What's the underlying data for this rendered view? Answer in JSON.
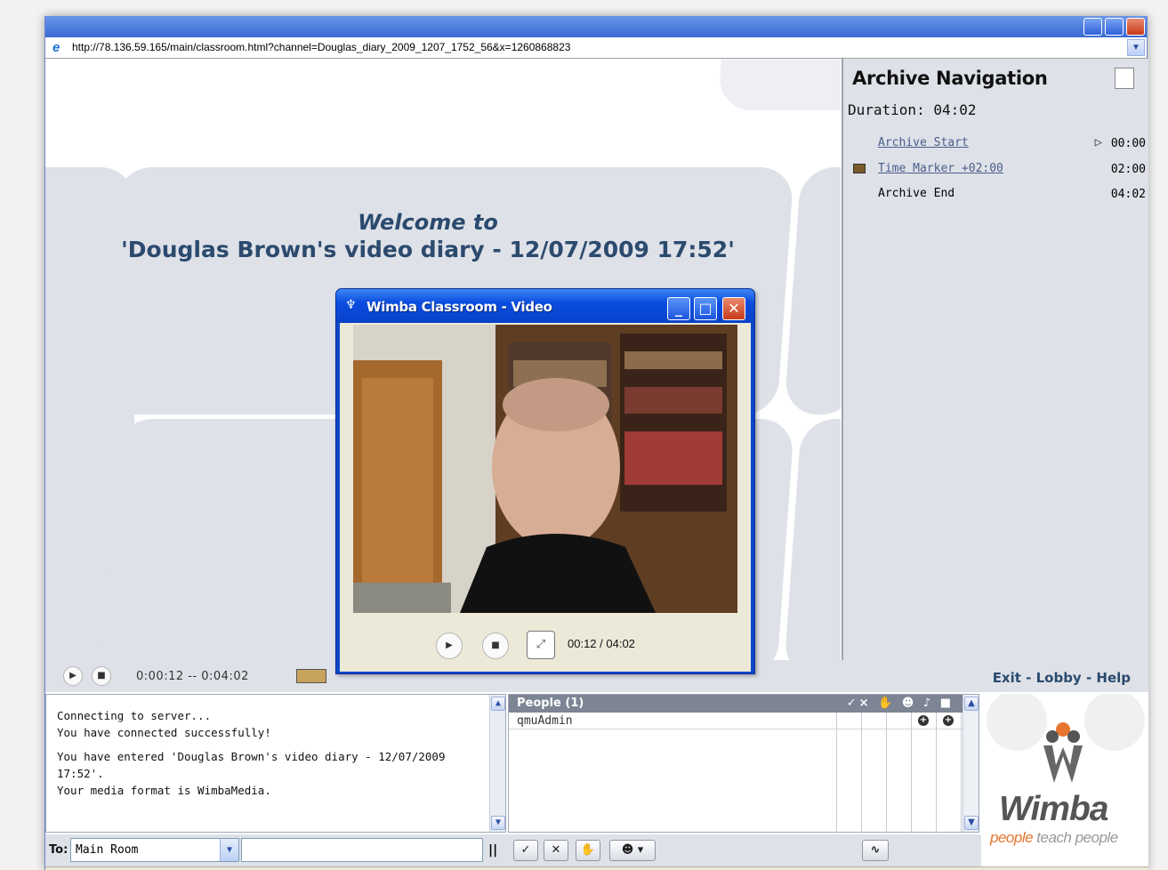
{
  "browser": {
    "url": "http://78.136.59.165/main/classroom.html?channel=Douglas_diary_2009_1207_1752_56&x=1260868823"
  },
  "stage": {
    "welcome_line1": "Welcome to",
    "welcome_line2": "'Douglas Brown's video diary - 12/07/2009 17:52'"
  },
  "player": {
    "timeline": "0:00:12 -- 0:04:02"
  },
  "archive_nav": {
    "title": "Archive Navigation",
    "duration": "Duration: 04:02",
    "items": [
      {
        "label": "Archive Start",
        "time": "00:00",
        "link": true
      },
      {
        "label": "Time Marker +02:00",
        "time": "02:00",
        "link": true
      },
      {
        "label": "Archive End",
        "time": "04:02",
        "link": false
      }
    ]
  },
  "footer_links": {
    "exit": "Exit",
    "lobby": "Lobby",
    "help": "Help",
    "separator": " - "
  },
  "chat": {
    "lines": [
      "Connecting to server...",
      "You have connected successfully!",
      "You have entered 'Douglas Brown's video diary - 12/07/2009 17:52'.",
      "Your media format is WimbaMedia."
    ]
  },
  "people": {
    "header": "People (1)",
    "header_icons": "✓×",
    "users": [
      "qmuAdmin"
    ]
  },
  "sendbar": {
    "to_label": "To:",
    "to_value": "Main Room",
    "message_placeholder": ""
  },
  "logo": {
    "brand": "Wimba",
    "tagline_part1": "people",
    "tagline_part2": " teach people"
  },
  "video_window": {
    "title": "Wimba Classroom - Video",
    "time": "00:12 / 04:02"
  },
  "colors": {
    "panel_bg": "#dee1e8",
    "heading_blue": "#2b4a6e",
    "xp_blue": "#0d47c9",
    "wimba_orange": "#e8752e"
  }
}
